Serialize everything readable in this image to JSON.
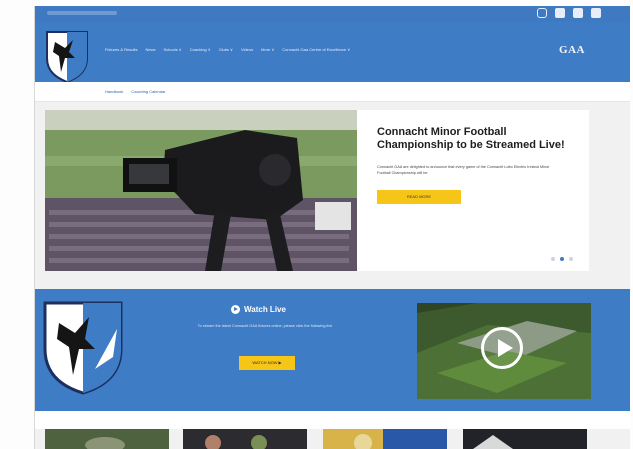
{
  "nav": {
    "menu": [
      "Fixtures & Results",
      "News",
      "Schools ∨",
      "Coaching ∨",
      "Clubs ∨",
      "Videos",
      "More ∨",
      "Connacht Gaa Centre of Excellence ∨"
    ],
    "brand": "GAA"
  },
  "subnav": {
    "links": [
      "Handbook",
      "Coaching Calendar"
    ]
  },
  "social": [
    "instagram-icon",
    "facebook-icon",
    "twitter-icon",
    "youtube-icon"
  ],
  "hero": {
    "title": "Connacht Minor Football Championship to be Streamed Live!",
    "body": "Connacht GAA are delighted to announce that every game of the Connacht Lotto Electric Ireland Minor Football Championship will be",
    "button": "READ MORE",
    "slides": 3,
    "active_slide": 2
  },
  "watch": {
    "title": "Watch Live",
    "body": "To stream the latest Connacht GAA fixtures online, please click the following link",
    "button": "WATCH NOW ▶"
  },
  "colors": {
    "primary_blue": "#3f7cc6",
    "accent_yellow": "#f5c518"
  }
}
